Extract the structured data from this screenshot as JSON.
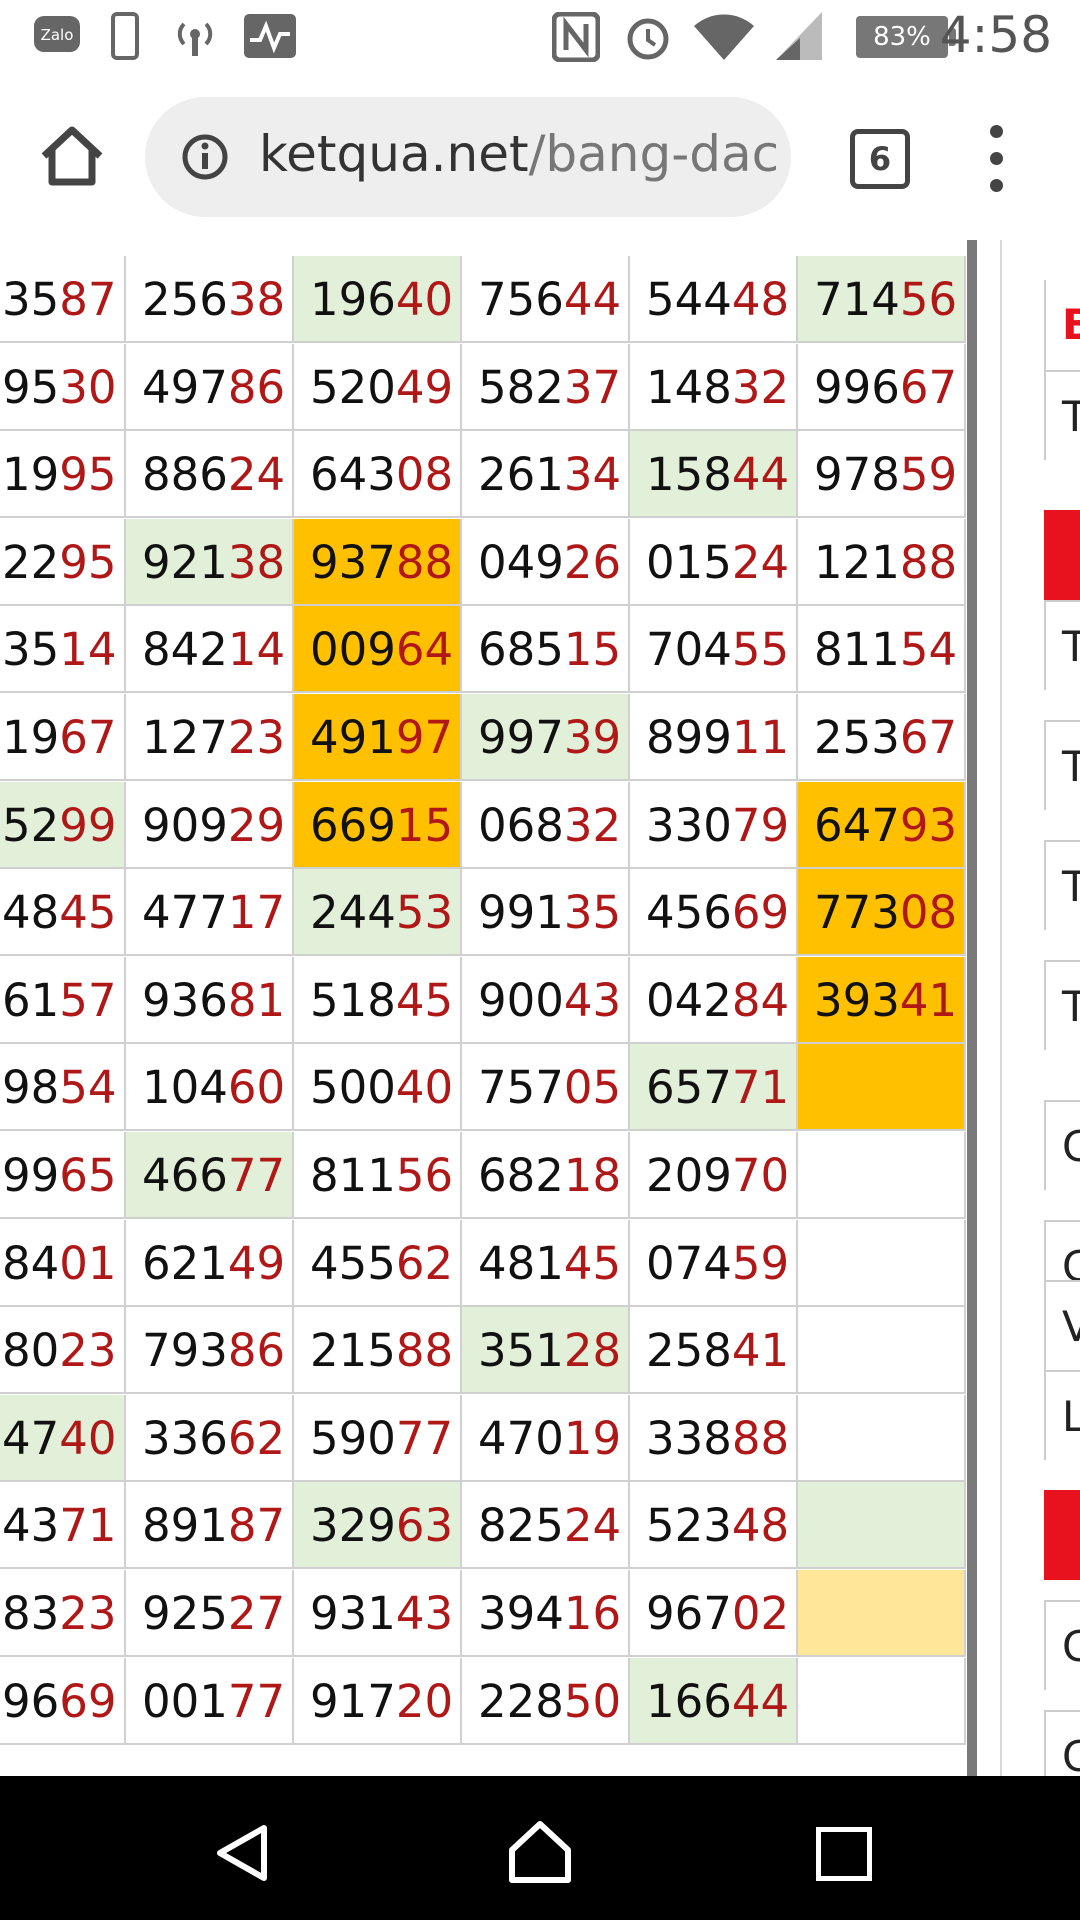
{
  "status_bar": {
    "time": "4:58",
    "battery_percent": "83%",
    "app_badge": "Zalo",
    "icons": [
      "zalo-icon",
      "phone-icon",
      "hotspot-icon",
      "activity-icon",
      "nfc-icon",
      "alarm-icon",
      "wifi-icon",
      "signal-icon",
      "battery-icon"
    ]
  },
  "browser": {
    "url_domain": "ketqua.net",
    "url_path": "/bang-dac",
    "tab_count": "6"
  },
  "table": {
    "rows": [
      [
        {
          "h": "35",
          "t": "87",
          "bg": ""
        },
        {
          "h": "256",
          "t": "38",
          "bg": ""
        },
        {
          "h": "196",
          "t": "40",
          "bg": "green"
        },
        {
          "h": "756",
          "t": "44",
          "bg": ""
        },
        {
          "h": "544",
          "t": "48",
          "bg": ""
        },
        {
          "h": "714",
          "t": "56",
          "bg": "green"
        }
      ],
      [
        {
          "h": "95",
          "t": "30",
          "bg": ""
        },
        {
          "h": "497",
          "t": "86",
          "bg": ""
        },
        {
          "h": "520",
          "t": "49",
          "bg": ""
        },
        {
          "h": "582",
          "t": "37",
          "bg": ""
        },
        {
          "h": "148",
          "t": "32",
          "bg": ""
        },
        {
          "h": "996",
          "t": "67",
          "bg": ""
        }
      ],
      [
        {
          "h": "19",
          "t": "95",
          "bg": ""
        },
        {
          "h": "886",
          "t": "24",
          "bg": ""
        },
        {
          "h": "643",
          "t": "08",
          "bg": ""
        },
        {
          "h": "261",
          "t": "34",
          "bg": ""
        },
        {
          "h": "158",
          "t": "44",
          "bg": "green"
        },
        {
          "h": "978",
          "t": "59",
          "bg": ""
        }
      ],
      [
        {
          "h": "22",
          "t": "95",
          "bg": ""
        },
        {
          "h": "921",
          "t": "38",
          "bg": "green"
        },
        {
          "h": "937",
          "t": "88",
          "bg": "orange"
        },
        {
          "h": "049",
          "t": "26",
          "bg": ""
        },
        {
          "h": "015",
          "t": "24",
          "bg": ""
        },
        {
          "h": "121",
          "t": "88",
          "bg": ""
        }
      ],
      [
        {
          "h": "35",
          "t": "14",
          "bg": ""
        },
        {
          "h": "842",
          "t": "14",
          "bg": ""
        },
        {
          "h": "009",
          "t": "64",
          "bg": "orange"
        },
        {
          "h": "685",
          "t": "15",
          "bg": ""
        },
        {
          "h": "704",
          "t": "55",
          "bg": ""
        },
        {
          "h": "811",
          "t": "54",
          "bg": ""
        }
      ],
      [
        {
          "h": "19",
          "t": "67",
          "bg": ""
        },
        {
          "h": "127",
          "t": "23",
          "bg": ""
        },
        {
          "h": "491",
          "t": "97",
          "bg": "orange"
        },
        {
          "h": "997",
          "t": "39",
          "bg": "green"
        },
        {
          "h": "899",
          "t": "11",
          "bg": ""
        },
        {
          "h": "253",
          "t": "67",
          "bg": ""
        }
      ],
      [
        {
          "h": "52",
          "t": "99",
          "bg": "green"
        },
        {
          "h": "909",
          "t": "29",
          "bg": ""
        },
        {
          "h": "669",
          "t": "15",
          "bg": "orange"
        },
        {
          "h": "068",
          "t": "32",
          "bg": ""
        },
        {
          "h": "330",
          "t": "79",
          "bg": ""
        },
        {
          "h": "647",
          "t": "93",
          "bg": "orange"
        }
      ],
      [
        {
          "h": "48",
          "t": "45",
          "bg": ""
        },
        {
          "h": "477",
          "t": "17",
          "bg": ""
        },
        {
          "h": "244",
          "t": "53",
          "bg": "green"
        },
        {
          "h": "991",
          "t": "35",
          "bg": ""
        },
        {
          "h": "456",
          "t": "69",
          "bg": ""
        },
        {
          "h": "773",
          "t": "08",
          "bg": "orange"
        }
      ],
      [
        {
          "h": "61",
          "t": "57",
          "bg": ""
        },
        {
          "h": "936",
          "t": "81",
          "bg": ""
        },
        {
          "h": "518",
          "t": "45",
          "bg": ""
        },
        {
          "h": "900",
          "t": "43",
          "bg": ""
        },
        {
          "h": "042",
          "t": "84",
          "bg": ""
        },
        {
          "h": "393",
          "t": "41",
          "bg": "orange"
        }
      ],
      [
        {
          "h": "98",
          "t": "54",
          "bg": ""
        },
        {
          "h": "104",
          "t": "60",
          "bg": ""
        },
        {
          "h": "500",
          "t": "40",
          "bg": ""
        },
        {
          "h": "757",
          "t": "05",
          "bg": ""
        },
        {
          "h": "657",
          "t": "71",
          "bg": "green"
        },
        {
          "h": "",
          "t": "",
          "bg": "orange"
        }
      ],
      [
        {
          "h": "99",
          "t": "65",
          "bg": ""
        },
        {
          "h": "466",
          "t": "77",
          "bg": "green"
        },
        {
          "h": "811",
          "t": "56",
          "bg": ""
        },
        {
          "h": "682",
          "t": "18",
          "bg": ""
        },
        {
          "h": "209",
          "t": "70",
          "bg": ""
        },
        {
          "h": "",
          "t": "",
          "bg": ""
        }
      ],
      [
        {
          "h": "84",
          "t": "01",
          "bg": ""
        },
        {
          "h": "621",
          "t": "49",
          "bg": ""
        },
        {
          "h": "455",
          "t": "62",
          "bg": ""
        },
        {
          "h": "481",
          "t": "45",
          "bg": ""
        },
        {
          "h": "074",
          "t": "59",
          "bg": ""
        },
        {
          "h": "",
          "t": "",
          "bg": ""
        }
      ],
      [
        {
          "h": "80",
          "t": "23",
          "bg": ""
        },
        {
          "h": "793",
          "t": "86",
          "bg": ""
        },
        {
          "h": "215",
          "t": "88",
          "bg": ""
        },
        {
          "h": "351",
          "t": "28",
          "bg": "green"
        },
        {
          "h": "258",
          "t": "41",
          "bg": ""
        },
        {
          "h": "",
          "t": "",
          "bg": ""
        }
      ],
      [
        {
          "h": "47",
          "t": "40",
          "bg": "green"
        },
        {
          "h": "336",
          "t": "62",
          "bg": ""
        },
        {
          "h": "590",
          "t": "77",
          "bg": ""
        },
        {
          "h": "470",
          "t": "19",
          "bg": ""
        },
        {
          "h": "338",
          "t": "88",
          "bg": ""
        },
        {
          "h": "",
          "t": "",
          "bg": ""
        }
      ],
      [
        {
          "h": "43",
          "t": "71",
          "bg": ""
        },
        {
          "h": "891",
          "t": "87",
          "bg": ""
        },
        {
          "h": "329",
          "t": "63",
          "bg": "green"
        },
        {
          "h": "825",
          "t": "24",
          "bg": ""
        },
        {
          "h": "523",
          "t": "48",
          "bg": ""
        },
        {
          "h": "",
          "t": "",
          "bg": "green"
        }
      ],
      [
        {
          "h": "83",
          "t": "23",
          "bg": ""
        },
        {
          "h": "925",
          "t": "27",
          "bg": ""
        },
        {
          "h": "931",
          "t": "43",
          "bg": ""
        },
        {
          "h": "394",
          "t": "16",
          "bg": ""
        },
        {
          "h": "967",
          "t": "02",
          "bg": ""
        },
        {
          "h": "",
          "t": "",
          "bg": "lightyellow"
        }
      ],
      [
        {
          "h": "96",
          "t": "69",
          "bg": ""
        },
        {
          "h": "001",
          "t": "77",
          "bg": ""
        },
        {
          "h": "917",
          "t": "20",
          "bg": ""
        },
        {
          "h": "228",
          "t": "50",
          "bg": ""
        },
        {
          "h": "166",
          "t": "44",
          "bg": "green"
        },
        {
          "h": "",
          "t": "",
          "bg": ""
        }
      ]
    ]
  },
  "sidebar_letters": [
    "B",
    "T",
    "T",
    "T",
    "T",
    "T",
    "C",
    "C",
    "V",
    "L",
    "C",
    "C"
  ],
  "colors": {
    "tail": "#b01818",
    "green": "#e2f0d9",
    "orange": "#ffc000",
    "lightyellow": "#ffe699",
    "red_accent": "#e8121f"
  }
}
